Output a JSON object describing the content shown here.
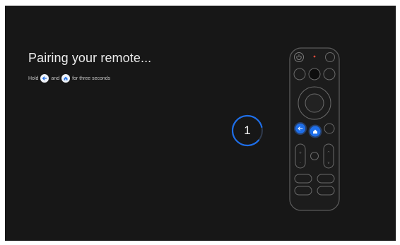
{
  "pairing": {
    "title": "Pairing your remote...",
    "hint_hold": "Hold",
    "hint_and": "and",
    "hint_suffix": "for three seconds",
    "countdown": "1"
  },
  "icons": {
    "back": "back-arrow-icon",
    "home": "home-icon",
    "power": "power-icon"
  },
  "colors": {
    "background": "#171717",
    "accent": "#1e6ee8",
    "highlight": "#3b82f6"
  }
}
